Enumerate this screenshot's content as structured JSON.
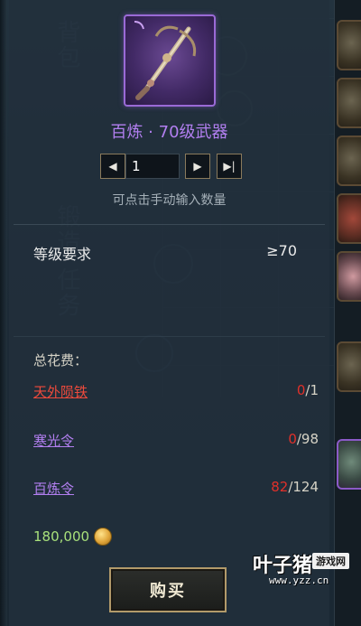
{
  "item": {
    "icon": "crossbow-weapon-icon",
    "title": "百炼 · 70级武器"
  },
  "quantity": {
    "value": "1",
    "hint": "可点击手动输入数量",
    "prev_icon": "◀",
    "next_icon": "▶",
    "max_icon": "▶|"
  },
  "requirement": {
    "label": "等级要求",
    "value": "≥70"
  },
  "cost": {
    "title": "总花费：",
    "materials": [
      {
        "name": "天外陨铁",
        "have": "0",
        "need": "/1",
        "color": "#ee4a3c"
      },
      {
        "name": "寒光令",
        "have": "0",
        "need": "/98",
        "color": "#b27ff0"
      },
      {
        "name": "百炼令",
        "have": "82",
        "need": "/124",
        "color": "#b27ff0"
      }
    ],
    "money": "180,000",
    "money_icon": "gold-coin-icon"
  },
  "buy_button": {
    "label": "购买"
  },
  "background_tabs": [
    "背包",
    "锻造",
    "任务"
  ],
  "watermark": {
    "main": "叶子猪",
    "badge": "游戏网",
    "url": "www.yzz.cn"
  },
  "colors": {
    "accent_purple": "#b27ff0",
    "warn_red": "#e0302a",
    "money_green": "#a8e07b"
  }
}
